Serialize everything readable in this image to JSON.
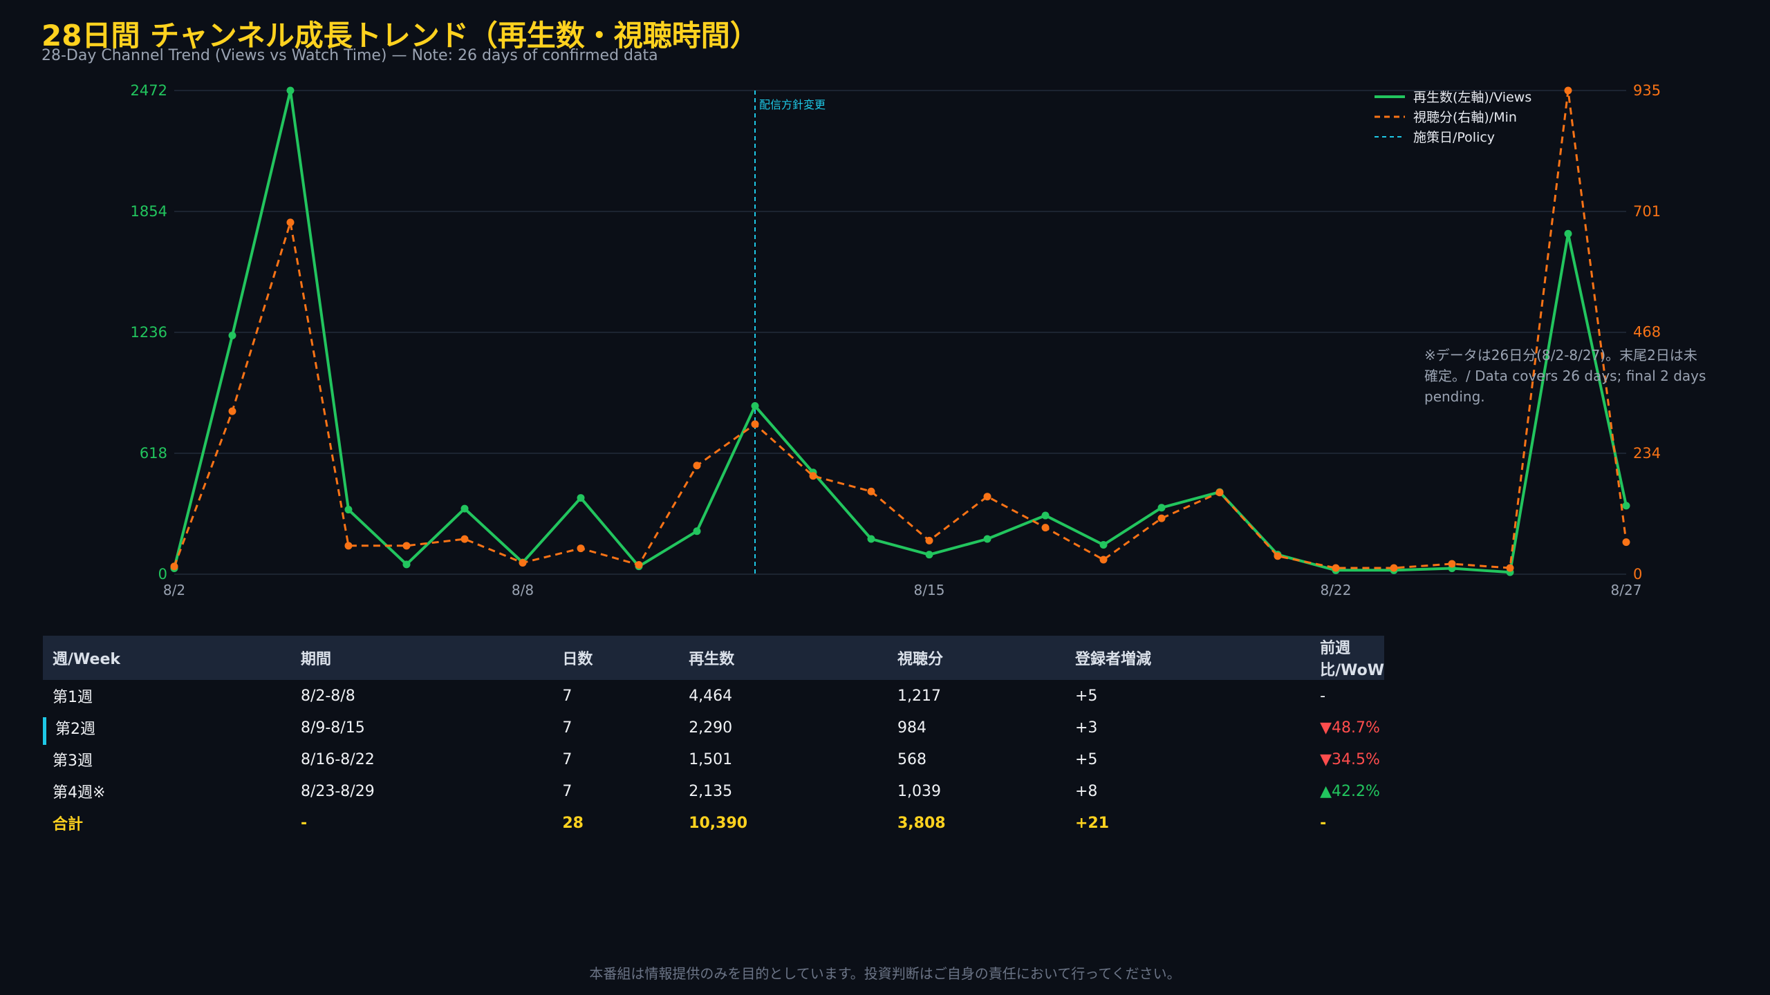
{
  "page": {
    "title": "28日間 チャンネル成長トレンド（再生数・視聴時間）",
    "subtitle": "28-Day Channel Trend (Views vs Watch Time) — Note: 26 days of confirmed data",
    "footer": "本番組は情報提供のみを目的としています。投資判断はご自身の責任において行ってください。"
  },
  "colors": {
    "views": "#22c55e",
    "watch": "#f97316",
    "policy": "#1ec8e6",
    "grid": "#232b3a",
    "axis": "#9aa3b2",
    "title": "#ffd21f"
  },
  "chart_data": {
    "type": "line",
    "x": [
      "8/2",
      "8/3",
      "8/4",
      "8/5",
      "8/6",
      "8/7",
      "8/8",
      "8/9",
      "8/10",
      "8/11",
      "8/12",
      "8/13",
      "8/14",
      "8/15",
      "8/16",
      "8/17",
      "8/18",
      "8/19",
      "8/20",
      "8/21",
      "8/22",
      "8/23",
      "8/24",
      "8/25",
      "8/26",
      "8/27"
    ],
    "x_tick_labels": [
      "8/2",
      "8/8",
      "8/15",
      "8/22",
      "8/27"
    ],
    "x_tick_indices": [
      0,
      6,
      13,
      20,
      25
    ],
    "series": [
      {
        "name": "再生数(左軸)/Views",
        "axis": "left",
        "style": "solid",
        "values": [
          30,
          1220,
          2472,
          330,
          50,
          335,
          60,
          390,
          40,
          220,
          860,
          520,
          180,
          100,
          180,
          300,
          150,
          340,
          420,
          100,
          20,
          20,
          30,
          10,
          1740,
          350
        ]
      },
      {
        "name": "視聴分(右軸)/Min",
        "axis": "right",
        "style": "dashed",
        "values": [
          15,
          315,
          680,
          55,
          55,
          68,
          22,
          50,
          18,
          210,
          290,
          190,
          160,
          65,
          150,
          90,
          28,
          108,
          158,
          35,
          12,
          12,
          20,
          12,
          935,
          62
        ]
      }
    ],
    "y_left": {
      "ticks": [
        0,
        618,
        1236,
        1854,
        2472
      ],
      "range": [
        0,
        2472
      ]
    },
    "y_right": {
      "ticks": [
        0,
        234,
        468,
        701,
        935
      ],
      "range": [
        0,
        935
      ]
    },
    "policy_line": {
      "x_index": 10,
      "label": "配信方針変更"
    },
    "legend": {
      "position": "top-right",
      "policy_label": "施策日/Policy"
    },
    "annotation": [
      "※データは26日分(8/2-8/27)。末尾2日は未",
      "確定。/ Data covers 26 days; final 2 days",
      "pending."
    ]
  },
  "table": {
    "headers": [
      "週/Week",
      "期間",
      "日数",
      "再生数",
      "視聴分",
      "登録者増減",
      "前週比/WoW"
    ],
    "rows": [
      {
        "week": "第1週",
        "period": "8/2-8/8",
        "days": "7",
        "views": "4,464",
        "minutes": "1,217",
        "subs": "+5",
        "wow": "-",
        "dir": "none",
        "highlight": false
      },
      {
        "week": "第2週",
        "period": "8/9-8/15",
        "days": "7",
        "views": "2,290",
        "minutes": "984",
        "subs": "+3",
        "wow": "▼48.7%",
        "dir": "down",
        "highlight": true
      },
      {
        "week": "第3週",
        "period": "8/16-8/22",
        "days": "7",
        "views": "1,501",
        "minutes": "568",
        "subs": "+5",
        "wow": "▼34.5%",
        "dir": "down",
        "highlight": false
      },
      {
        "week": "第4週※",
        "period": "8/23-8/29",
        "days": "7",
        "views": "2,135",
        "minutes": "1,039",
        "subs": "+8",
        "wow": "▲42.2%",
        "dir": "up",
        "highlight": false
      }
    ],
    "total": {
      "week": "合計",
      "period": "-",
      "days": "28",
      "views": "10,390",
      "minutes": "3,808",
      "subs": "+21",
      "wow": "-"
    }
  }
}
